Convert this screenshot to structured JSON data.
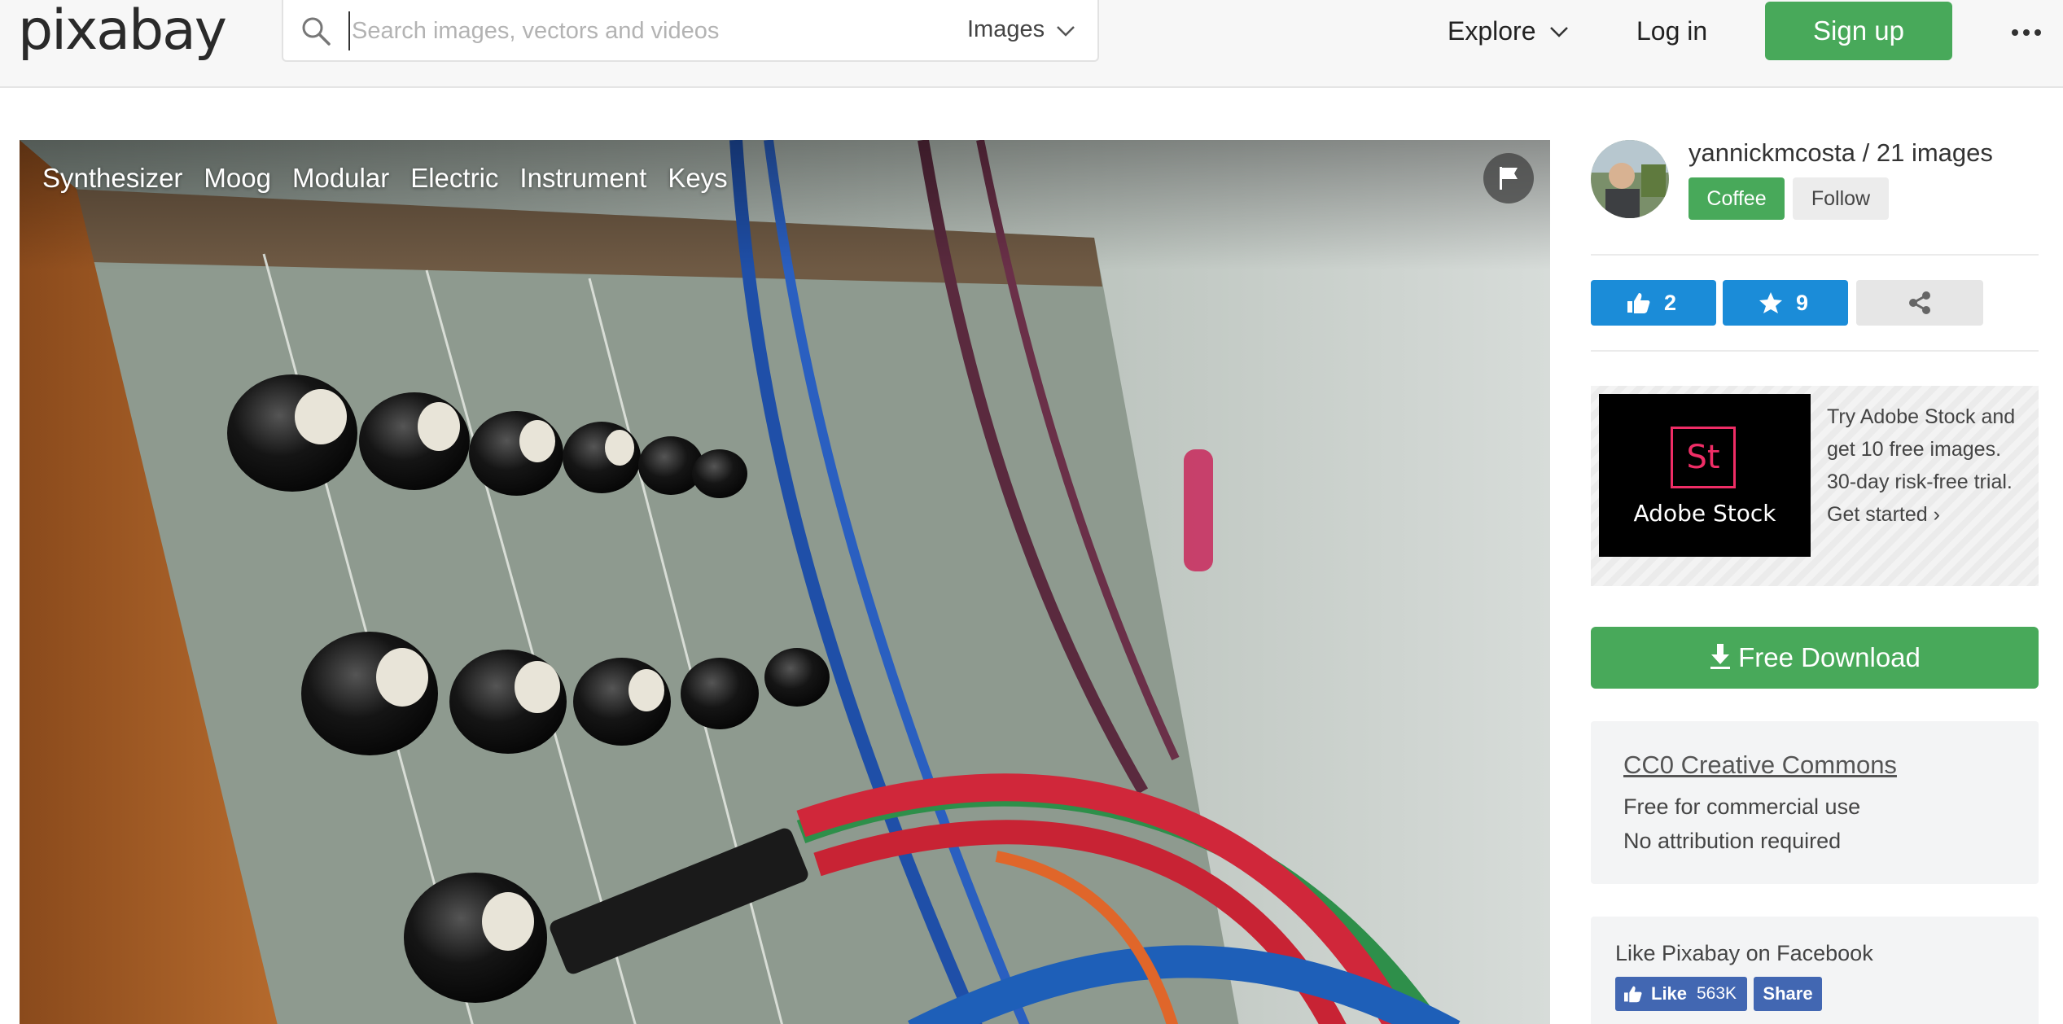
{
  "header": {
    "logo": "pixabay",
    "search_placeholder": "Search images, vectors and videos",
    "search_type": "Images",
    "explore_label": "Explore",
    "login_label": "Log in",
    "signup_label": "Sign up"
  },
  "photo": {
    "tags": [
      "Synthesizer",
      "Moog",
      "Modular",
      "Electric",
      "Instrument",
      "Keys"
    ]
  },
  "sidebar": {
    "user": "yannickmcosta / 21 images",
    "coffee_label": "Coffee",
    "follow_label": "Follow",
    "likes": "2",
    "favorites": "9",
    "ad": {
      "logo_mark": "St",
      "brand": "Adobe Stock",
      "text": "Try Adobe Stock and get 10 free images. 30-day risk-free trial. Get started ›"
    },
    "download_label": "Free Download",
    "license": {
      "title": "CC0 Creative Commons",
      "line1": "Free for commercial use",
      "line2": "No attribution required"
    },
    "facebook": {
      "title": "Like Pixabay on Facebook",
      "like_label": "Like",
      "like_count": "563K",
      "share_label": "Share"
    }
  },
  "colors": {
    "brand_green": "#48a95a",
    "action_blue": "#1b8cd8",
    "facebook_blue": "#4267b2",
    "adobe_pink": "#ef2d66"
  }
}
